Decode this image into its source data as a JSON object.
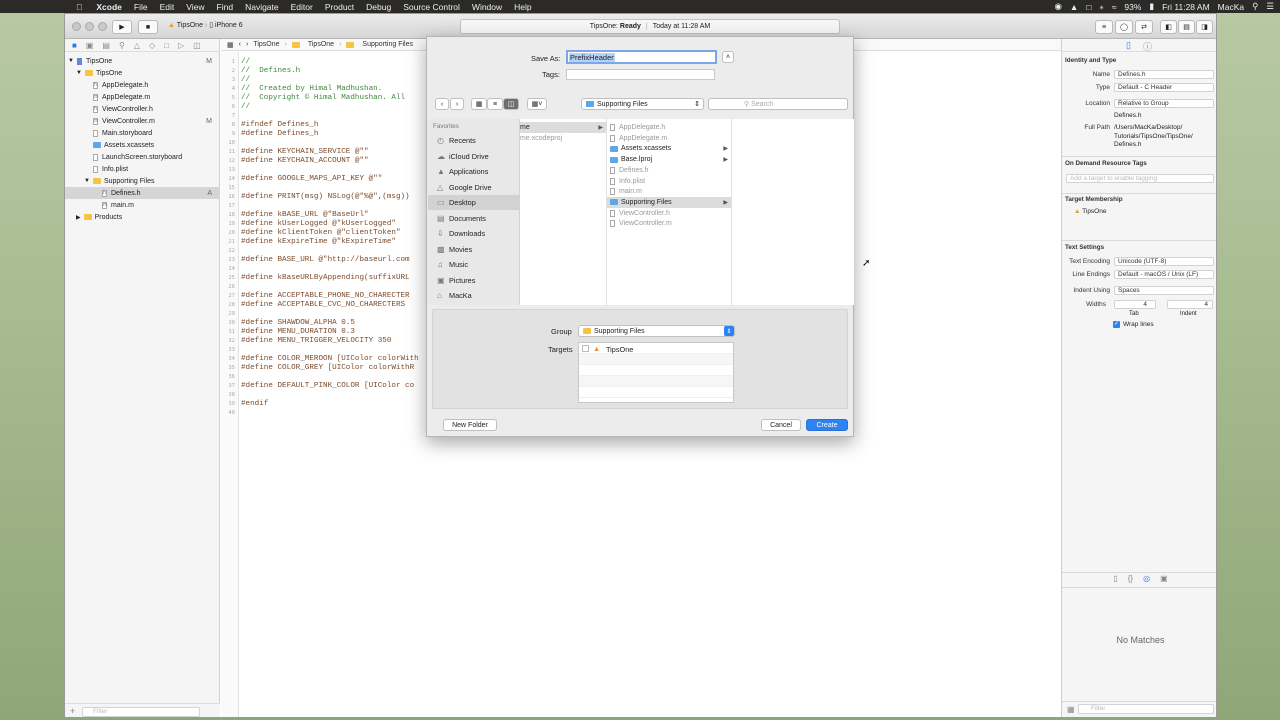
{
  "menubar": {
    "app": "Xcode",
    "items": [
      "File",
      "Edit",
      "View",
      "Find",
      "Navigate",
      "Editor",
      "Product",
      "Debug",
      "Source Control",
      "Window",
      "Help"
    ],
    "battery": "93%",
    "clock": "Fri 11:28 AM",
    "user": "MacKa"
  },
  "toolbar": {
    "scheme": "TipsOne",
    "device": "iPhone 6",
    "status_project": "TipsOne:",
    "status_state": "Ready",
    "status_time": "Today at 11:28 AM"
  },
  "navigator": {
    "rows": [
      {
        "label": "TipsOne",
        "flag": "M"
      },
      {
        "label": "TipsOne",
        "flag": ""
      },
      {
        "label": "AppDelegate.h",
        "flag": ""
      },
      {
        "label": "AppDelegate.m",
        "flag": ""
      },
      {
        "label": "ViewController.h",
        "flag": ""
      },
      {
        "label": "ViewController.m",
        "flag": "M"
      },
      {
        "label": "Main.storyboard",
        "flag": ""
      },
      {
        "label": "Assets.xcassets",
        "flag": ""
      },
      {
        "label": "LaunchScreen.storyboard",
        "flag": ""
      },
      {
        "label": "Info.plist",
        "flag": ""
      },
      {
        "label": "Supporting Files",
        "flag": ""
      },
      {
        "label": "Defines.h",
        "flag": "A"
      },
      {
        "label": "main.m",
        "flag": ""
      },
      {
        "label": "Products",
        "flag": ""
      }
    ],
    "filter_placeholder": "Filter"
  },
  "jumpbar": {
    "crumbs": [
      "TipsOne",
      "TipsOne",
      "Supporting Files"
    ]
  },
  "editor": {
    "lines": [
      {
        "n": "1",
        "t": "//",
        "c": "cm"
      },
      {
        "n": "2",
        "t": "//  Defines.h",
        "c": "cm"
      },
      {
        "n": "3",
        "t": "//",
        "c": "cm"
      },
      {
        "n": "4",
        "t": "//  Created by Himal Madhushan.",
        "c": "cm"
      },
      {
        "n": "5",
        "t": "//  Copyright © Himal Madhushan. All",
        "c": "cm"
      },
      {
        "n": "6",
        "t": "//",
        "c": "cm"
      },
      {
        "n": "7",
        "t": "",
        "c": ""
      },
      {
        "n": "8",
        "t": "#ifndef Defines_h",
        "c": "pp"
      },
      {
        "n": "9",
        "t": "#define Defines_h",
        "c": "pp"
      },
      {
        "n": "10",
        "t": "",
        "c": ""
      },
      {
        "n": "11",
        "t": "#define KEYCHAIN_SERVICE @\"\"",
        "c": "pp"
      },
      {
        "n": "12",
        "t": "#define KEYCHAIN_ACCOUNT @\"\"",
        "c": "pp"
      },
      {
        "n": "13",
        "t": "",
        "c": ""
      },
      {
        "n": "14",
        "t": "#define GOOGLE_MAPS_API_KEY @\"\"",
        "c": "pp"
      },
      {
        "n": "15",
        "t": "",
        "c": ""
      },
      {
        "n": "16",
        "t": "#define PRINT(msg) NSLog(@\"%@\",(msg))",
        "c": "pp"
      },
      {
        "n": "17",
        "t": "",
        "c": ""
      },
      {
        "n": "18",
        "t": "#define kBASE_URL @\"BaseUrl\"",
        "c": "pp"
      },
      {
        "n": "19",
        "t": "#define kUserLogged @\"kUserLogged\"",
        "c": "pp"
      },
      {
        "n": "20",
        "t": "#define kClientToken @\"clientToken\"",
        "c": "pp"
      },
      {
        "n": "21",
        "t": "#define kExpireTime @\"kExpireTime\"",
        "c": "pp"
      },
      {
        "n": "22",
        "t": "",
        "c": ""
      },
      {
        "n": "23",
        "t": "#define BASE_URL @\"http://baseurl.com",
        "c": "pp"
      },
      {
        "n": "24",
        "t": "",
        "c": ""
      },
      {
        "n": "25",
        "t": "#define kBaseURLByAppending(suffixURL",
        "c": "pp"
      },
      {
        "n": "26",
        "t": "",
        "c": ""
      },
      {
        "n": "27",
        "t": "#define ACCEPTABLE_PHONE_NO_CHARECTER",
        "c": "pp"
      },
      {
        "n": "28",
        "t": "#define ACCEPTABLE_CVC_NO_CHARECTERS",
        "c": "pp"
      },
      {
        "n": "29",
        "t": "",
        "c": ""
      },
      {
        "n": "30",
        "t": "#define SHAWDOW_ALPHA 0.5",
        "c": "pp"
      },
      {
        "n": "31",
        "t": "#define MENU_DURATION 0.3",
        "c": "pp"
      },
      {
        "n": "32",
        "t": "#define MENU_TRIGGER_VELOCITY 350",
        "c": "pp"
      },
      {
        "n": "33",
        "t": "",
        "c": ""
      },
      {
        "n": "34",
        "t": "#define COLOR_MEROON [UIColor colorWith",
        "c": "pp"
      },
      {
        "n": "35",
        "t": "#define COLOR_GREY [UIColor colorWithR",
        "c": "pp"
      },
      {
        "n": "36",
        "t": "",
        "c": ""
      },
      {
        "n": "37",
        "t": "#define DEFAULT_PINK_COLOR [UIColor co",
        "c": "pp"
      },
      {
        "n": "38",
        "t": "",
        "c": ""
      },
      {
        "n": "39",
        "t": "#endif",
        "c": "pp"
      },
      {
        "n": "40",
        "t": "",
        "c": ""
      }
    ]
  },
  "inspector": {
    "identity_header": "Identity and Type",
    "name_label": "Name",
    "name_value": "Defines.h",
    "type_label": "Type",
    "type_value": "Default - C Header",
    "location_label": "Location",
    "location_value": "Relative to Group",
    "location_file": "Defines.h",
    "fullpath_label": "Full Path",
    "fullpath_value": [
      "/Users/MacKa/Desktop/",
      "Tutorials/TipsOne/TipsOne/",
      "Defines.h"
    ],
    "odr_header": "On Demand Resource Tags",
    "odr_placeholder": "Add a target to enable tagging",
    "target_header": "Target Membership",
    "target_name": "TipsOne",
    "text_header": "Text Settings",
    "encoding_label": "Text Encoding",
    "encoding_value": "Unicode (UTF-8)",
    "endings_label": "Line Endings",
    "endings_value": "Default - macOS / Unix (LF)",
    "indent_label": "Indent Using",
    "indent_value": "Spaces",
    "widths_label": "Widths",
    "tab_value": "4",
    "indent_width_value": "4",
    "tab_label": "Tab",
    "indent_sub_label": "Indent",
    "wrap_label": "Wrap lines",
    "no_matches": "No Matches",
    "filter_placeholder": "Filter"
  },
  "sheet": {
    "saveas_label": "Save As:",
    "saveas_value": "PrefixHeader",
    "tags_label": "Tags:",
    "location_popup": "Supporting Files",
    "search_placeholder": "Search",
    "favorites_header": "Favorites",
    "favorites": [
      "Recents",
      "iCloud Drive",
      "Applications",
      "Google Drive",
      "Desktop",
      "Documents",
      "Downloads",
      "Movies",
      "Music",
      "Pictures",
      "MacKa"
    ],
    "col1": [
      "me",
      "me.xcodeproj"
    ],
    "col2": [
      {
        "label": "AppDelegate.h",
        "dim": true,
        "arrow": false
      },
      {
        "label": "AppDelegate.m",
        "dim": true,
        "arrow": false
      },
      {
        "label": "Assets.xcassets",
        "dim": false,
        "arrow": true
      },
      {
        "label": "Base.lproj",
        "dim": false,
        "arrow": true
      },
      {
        "label": "Defines.h",
        "dim": true,
        "arrow": false
      },
      {
        "label": "Info.plist",
        "dim": true,
        "arrow": false
      },
      {
        "label": "main.m",
        "dim": true,
        "arrow": false
      },
      {
        "label": "Supporting Files",
        "dim": false,
        "arrow": true
      },
      {
        "label": "ViewController.h",
        "dim": true,
        "arrow": false
      },
      {
        "label": "ViewController.m",
        "dim": true,
        "arrow": false
      }
    ],
    "group_label": "Group",
    "group_value": "Supporting Files",
    "targets_label": "Targets",
    "target_item": "TipsOne",
    "new_folder": "New Folder",
    "cancel": "Cancel",
    "create": "Create"
  }
}
